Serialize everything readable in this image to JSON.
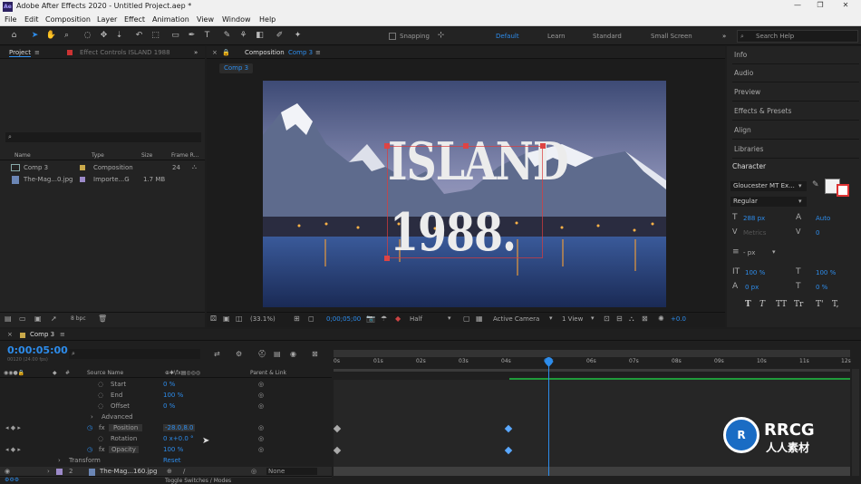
{
  "window": {
    "title": "Adobe After Effects 2020 - Untitled Project.aep *",
    "app_icon": "Ae"
  },
  "menu": [
    "File",
    "Edit",
    "Composition",
    "Layer",
    "Effect",
    "Animation",
    "View",
    "Window",
    "Help"
  ],
  "toolbar": {
    "snapping_label": "Snapping",
    "workspaces": [
      "Default",
      "Learn",
      "Standard",
      "Small Screen"
    ],
    "search_placeholder": "Search Help"
  },
  "project_panel": {
    "tab_label": "Project",
    "effect_controls_label": "Effect Controls ISLAND 1988",
    "columns": [
      "Name",
      "Type",
      "Size",
      "Frame R..."
    ],
    "items": [
      {
        "name": "Comp 3",
        "type": "Composition",
        "size": "",
        "frame": "24"
      },
      {
        "name": "The-Mag...0.jpg",
        "type": "Importe...G",
        "size": "1.7 MB",
        "frame": ""
      }
    ],
    "bpc": "8 bpc"
  },
  "composition": {
    "tab_label": "Composition",
    "comp_name": "Comp 3",
    "breadcrumb": "Comp 3",
    "title_line1": "ISLAND",
    "title_line2": "1988.",
    "zoom": "(33.1%)",
    "timecode": "0;00;05;00",
    "resolution": "Half",
    "camera": "Active Camera",
    "views": "1 View",
    "exposure": "+0.0"
  },
  "right_panels": [
    "Info",
    "Audio",
    "Preview",
    "Effects & Presets",
    "Align",
    "Libraries"
  ],
  "character": {
    "label": "Character",
    "font": "Gloucester MT Ex...",
    "style": "Regular",
    "size": "288 px",
    "leading": "Auto",
    "kerning": "Metrics",
    "tracking": "0",
    "stroke": "- px",
    "vscale": "100 %",
    "hscale": "100 %",
    "baseline": "0 px",
    "tsume": "0 %"
  },
  "timeline": {
    "comp_tab": "Comp 3",
    "timecode": "0:00:05:00",
    "frames": "00120 (24.00 fps)",
    "col_source": "Source Name",
    "col_parent": "Parent & Link",
    "ticks": [
      "0s",
      "01s",
      "02s",
      "03s",
      "04s",
      "05s",
      "06s",
      "07s",
      "08s",
      "09s",
      "10s",
      "11s",
      "12s"
    ],
    "rows": [
      {
        "label": "Start",
        "value": "0 %"
      },
      {
        "label": "End",
        "value": "100 %"
      },
      {
        "label": "Offset",
        "value": "0 %"
      },
      {
        "label": "Advanced",
        "value": ""
      },
      {
        "label": "Position",
        "value": "-28.0,8.0"
      },
      {
        "label": "Rotation",
        "value": "0 x+0.0 °"
      },
      {
        "label": "Opacity",
        "value": "100 %"
      },
      {
        "label": "Transform",
        "value": "Reset"
      },
      {
        "label": "The-Mag...160.jpg",
        "value": "None"
      }
    ],
    "layer_num": "2",
    "toggle_label": "Toggle Switches / Modes"
  },
  "watermark": {
    "text": "RRCG",
    "sub": "人人素材"
  },
  "colors": {
    "accent": "#2d8ceb",
    "panel": "#232323",
    "bg": "#1d1d1d",
    "keyframe": "#5aa8ff",
    "work_area": "#1f9b3a"
  }
}
